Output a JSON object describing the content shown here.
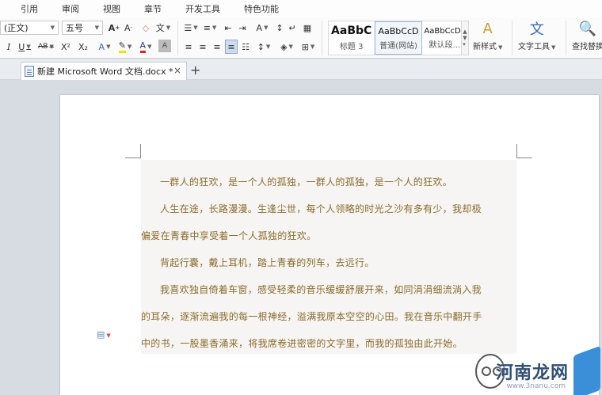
{
  "menu": {
    "tabs": [
      "引用",
      "审阅",
      "视图",
      "章节",
      "开发工具",
      "特色功能"
    ]
  },
  "ribbon": {
    "font_name": "(正文)",
    "font_size": "五号",
    "styles": [
      {
        "sample": "AaBbC",
        "name": "标题 3"
      },
      {
        "sample": "AaBbCcD",
        "name": "普通(网站)"
      },
      {
        "sample": "AaBbCcDc",
        "name": "默认段..."
      }
    ],
    "new_style_label": "新样式",
    "text_tools_label": "文字工具",
    "find_replace_label": "查找替换",
    "glyphs": {
      "italic": "I",
      "underline": "U",
      "strike": "AB",
      "superscript": "X²",
      "subscript": "X₂",
      "font_color": "A",
      "phonetic": "文"
    }
  },
  "document_tab": {
    "title": "新建 Microsoft Word 文档.docx *",
    "close": "×",
    "add": "+"
  },
  "document": {
    "lines": [
      "一群人的狂欢，是一个人的孤独，一群人的孤独，是一个人的狂欢。",
      "人生在途，长路漫漫。生逢尘世，每个人领略的时光之沙有多有少，我却极",
      "偏爱在青春中享受着一个人孤独的狂欢。",
      "背起行囊，戴上耳机，踏上青春的列车，去远行。",
      "我喜欢独自倚着车窗，感受轻柔的音乐缓缓舒展开来，如同涓涓细流淌入我",
      "的耳朵，逐渐流遍我的每一根神经，溢满我原本空空的心田。我在音乐中翻开手",
      "中的书，一股墨香涌来，将我席卷进密密的文字里，而我的孤独由此开始。"
    ]
  },
  "watermark": {
    "brand": "河南龙网",
    "url": "www.3nanu.com"
  },
  "colors": {
    "text": "#8a6b2c",
    "accent": "#3a6db0"
  }
}
